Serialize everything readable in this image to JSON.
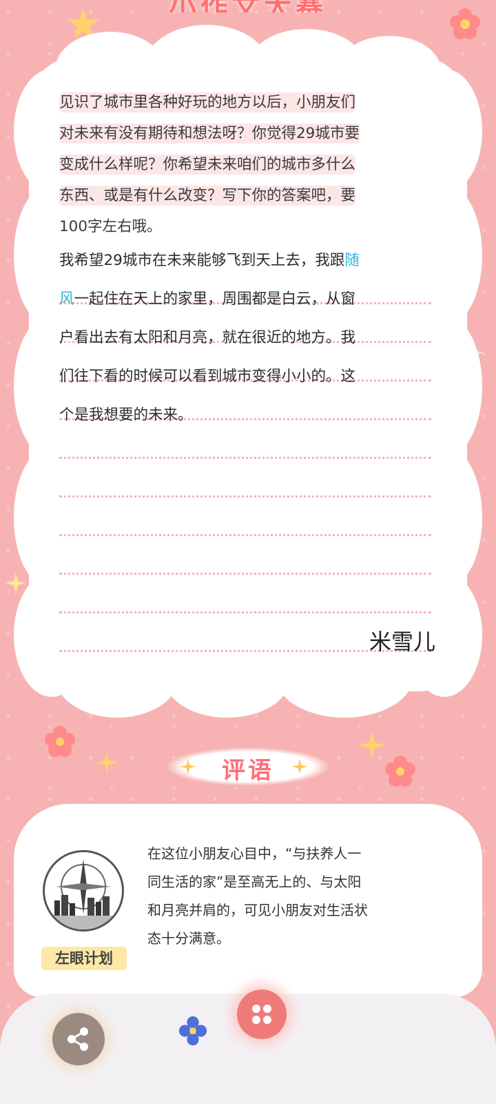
{
  "header": {
    "title": "小作文大赛"
  },
  "essay": {
    "question_lines": [
      "见识了城市里各种好玩的地方以后，小朋友们",
      "对未来有没有期待和想法呀？你觉得29城市要",
      "变成什么样呢？你希望未来咱们的城市多什么",
      "东西、或是有什么改变？写下你的答案吧，要",
      "100字左右哦。"
    ],
    "answer_line1_prefix": "我希望29城市在未来能够飞到天上去，我跟",
    "answer_name_part1": "随",
    "answer_name_part2": "风",
    "answer_line2_rest": "一起住在天上的家里，周围都是白云，从窗",
    "answer_line3": "户看出去有太阳和月亮，就在很近的地方。我",
    "answer_line4": "们往下看的时候可以看到城市变得小小的。这",
    "answer_line5": "个是我想要的未来。",
    "signature": "米雪儿"
  },
  "comment": {
    "title": "评语",
    "lines": [
      "在这位小朋友心目中，“与扶养人一",
      "同生活的家”是至高无上的、与太阳",
      "和月亮并肩的，可见小朋友对生活状",
      "态十分满意。"
    ],
    "author": "左眼计划"
  },
  "actions": {
    "share_icon": "share-icon",
    "close_icon": "close-icon"
  },
  "colors": {
    "accent": "#ff6f7a",
    "name_link": "#2eb3d8",
    "background": "#f7b3b3"
  }
}
